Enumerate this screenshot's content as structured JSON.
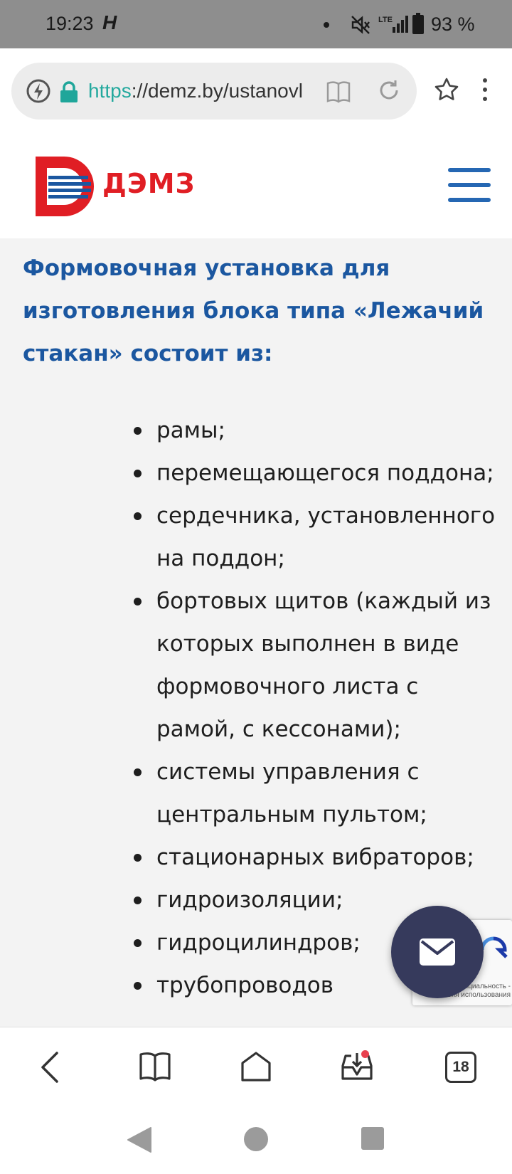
{
  "status_bar": {
    "time": "19:23",
    "carrier_glyph": "H",
    "network": "LTE",
    "battery": "93 %",
    "icons": [
      "notification-dot-icon",
      "mute-icon",
      "signal-icon",
      "battery-icon"
    ]
  },
  "browser": {
    "url_scheme": "https",
    "url_rest": "://demz.by/ustanovl",
    "icons": [
      "bolt-icon",
      "lock-icon",
      "reader-icon",
      "reload-icon",
      "star-icon",
      "menu-dots-icon"
    ]
  },
  "site": {
    "logo_text": "ДЭМЗ",
    "brand_colors": {
      "red": "#e01e24",
      "blue": "#1b57a0"
    }
  },
  "article": {
    "heading": "Формовочная установка для изготовления блока типа «Лежачий стакан» состоит из:",
    "items": [
      "рамы;",
      "перемещающегося поддона;",
      "сердечника, установленного на поддон;",
      "бортовых щитов (каждый из которых выполнен в виде формовочного листа с рамой, с кессонами);",
      "системы управления с центральным пультом;",
      "стационарных вибраторов;",
      "гидроизоляции;",
      "гидроцилиндров;",
      "трубопроводов"
    ]
  },
  "recaptcha": {
    "text": "фиденциальность - Условия использования"
  },
  "toolbar": {
    "tabs_count": "18",
    "icons": [
      "back-icon",
      "bookmarks-icon",
      "home-icon",
      "download-icon",
      "tabs-icon"
    ]
  },
  "android_nav": {
    "icons": [
      "nav-back-icon",
      "nav-home-icon",
      "nav-recent-icon"
    ]
  }
}
